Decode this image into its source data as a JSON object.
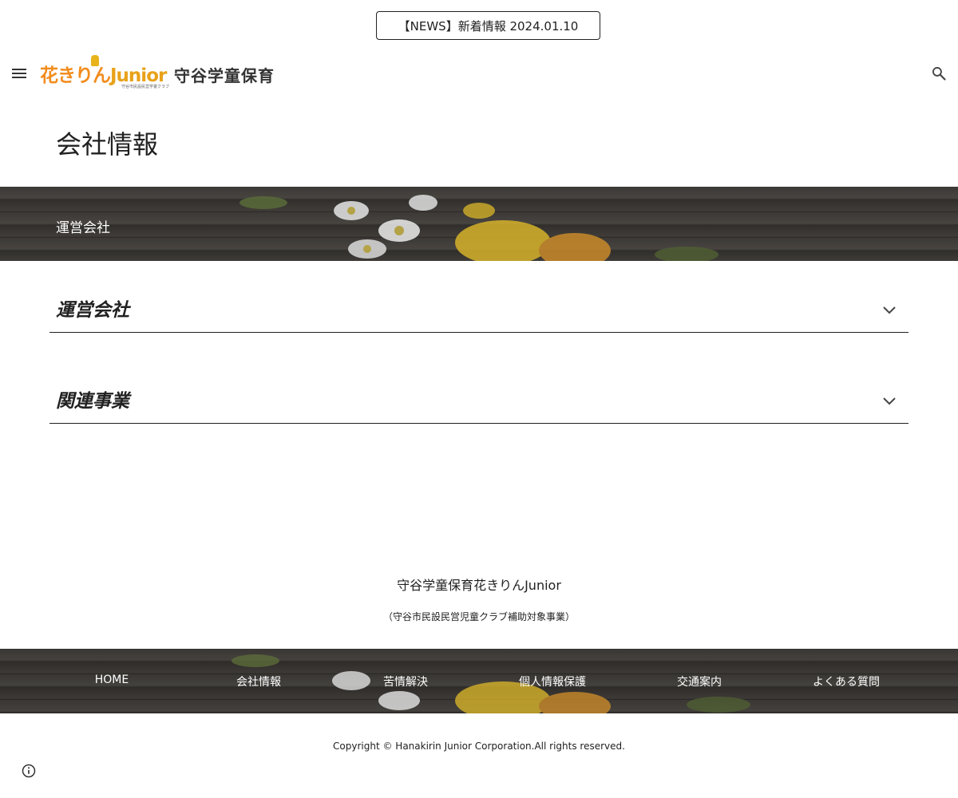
{
  "news_button": {
    "label": "【NEWS】新着情報 2024.01.10"
  },
  "header": {
    "logo": {
      "text_part1": "花きりん",
      "text_part2": "Junior",
      "subtext": "守谷市民設民営学童クラブ"
    },
    "site_title": "守谷学童保育"
  },
  "page_title": "会社情報",
  "banner": {
    "text": "運営会社"
  },
  "accordions": [
    {
      "title": "運営会社"
    },
    {
      "title": "関連事業"
    }
  ],
  "footer": {
    "name": "守谷学童保育花きりんJunior",
    "sub": "（守谷市民設民営児童クラブ補助対象事業）",
    "nav": [
      "HOME",
      "会社情報",
      "苦情解決",
      "個人情報保護",
      "交通案内",
      "よくある質問"
    ],
    "copyright": "Copyright © Hanakirin Junior Corporation.All rights reserved."
  },
  "colors": {
    "logo_orange": "#f28c1e",
    "logo_yellow": "#e8a21a",
    "text": "#212121"
  }
}
